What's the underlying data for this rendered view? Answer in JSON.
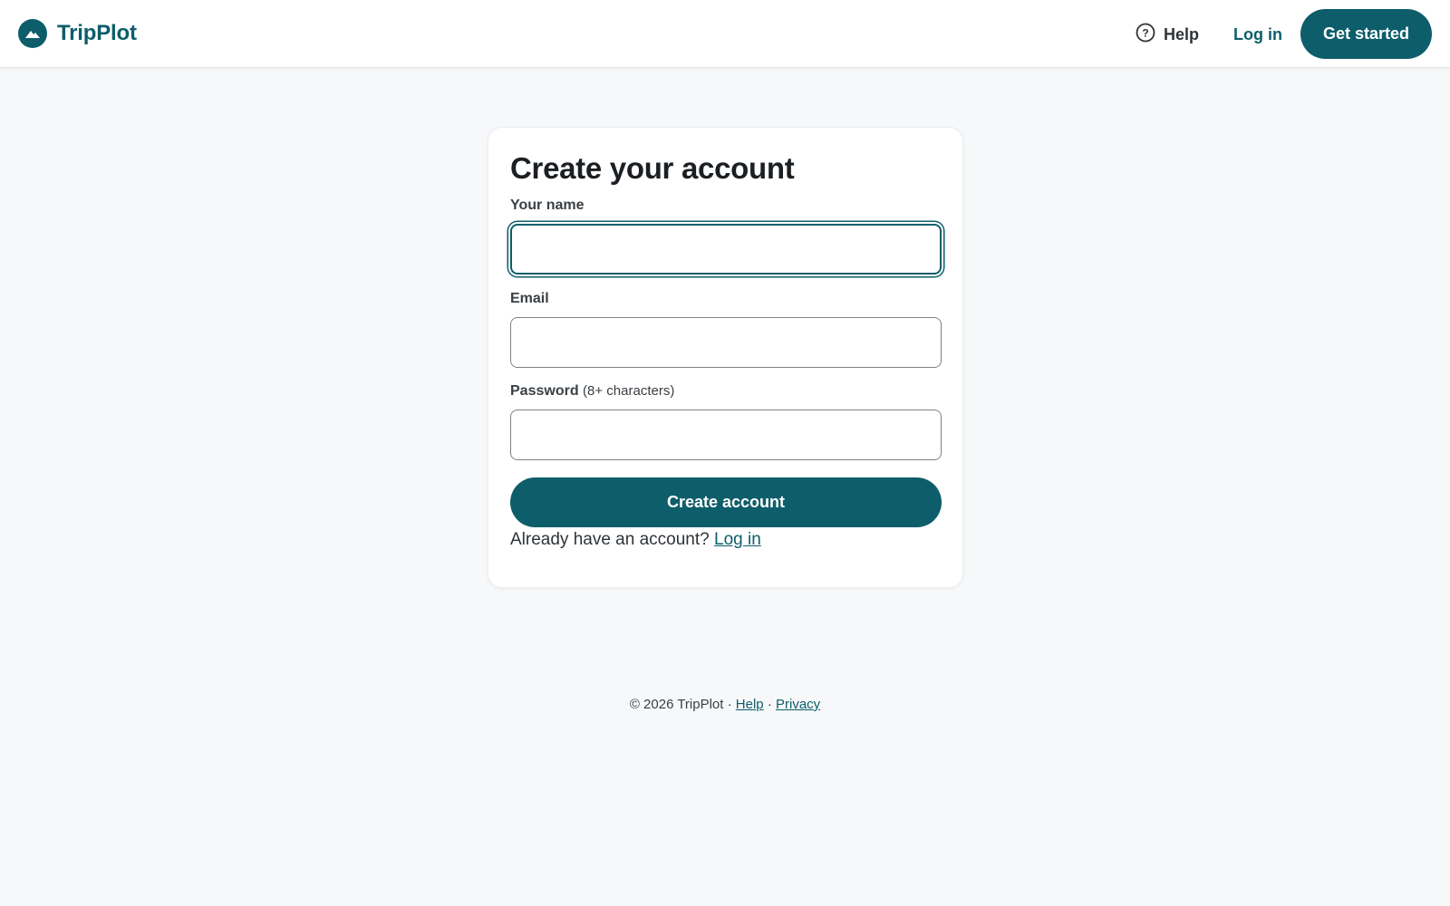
{
  "header": {
    "brand_name": "TripPlot",
    "logo_icon": "mountain-logo-icon",
    "help_label": "Help",
    "help_icon": "question-circle-icon",
    "login_label": "Log in",
    "get_started_label": "Get started"
  },
  "signup": {
    "title": "Create your account",
    "name_label": "Your name",
    "name_value": "",
    "email_label": "Email",
    "email_value": "",
    "password_label": "Password",
    "password_hint": "(8+ characters)",
    "password_value": "",
    "submit_label": "Create account",
    "already_text": "Already have an account?",
    "login_link_label": "Log in"
  },
  "footer": {
    "copyright": "© 2026 TripPlot",
    "separator": "·",
    "help_label": "Help",
    "privacy_label": "Privacy"
  },
  "colors": {
    "brand": "#0d5e6a",
    "page_background": "#f7f8f9",
    "card_background": "#ffffff"
  }
}
